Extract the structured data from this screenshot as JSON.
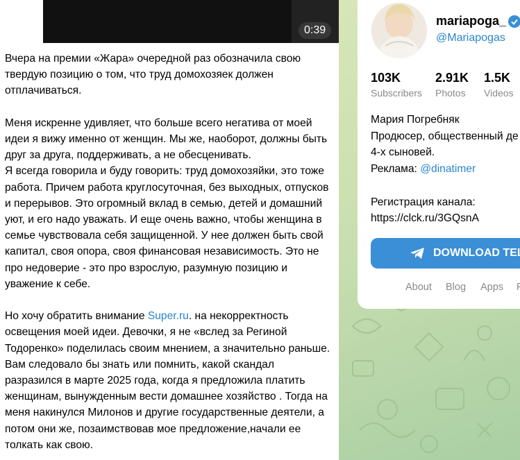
{
  "video": {
    "duration": "0:39"
  },
  "post": {
    "p1": "Вчера на премии «Жара» очередной раз обозначила свою твердую позицию о том, что труд домохозяек должен отплачиваться.",
    "p2a": "Меня искренне удивляет, что больше всего негатива от моей идеи я вижу именно от женщин. Мы же, наоборот, должны быть друг за друга, поддерживать, а не обесценивать.",
    "p2b": "Я всегда говорила и буду говорить: труд домохозяйки, это тоже работа. Причем работа круглосуточная, без выходных, отпусков и перерывов. Это огромный вклад в семью, детей и домашний уют, и его надо уважать. И еще очень важно, чтобы женщина в семье чувствовала себя защищенной. У нее должен быть свой капитал, своя опора, своя финансовая независимость. Это не про недоверие - это про взрослую, разумную позицию и уважение к себе.",
    "p3_pre": "Но хочу обратить внимание ",
    "p3_link": "Super.ru",
    "p3_post": ". на некорректность освещения моей идеи. Девочки, я не «вслед за Региной Тодоренко» поделилась своим мнением, а значительно раньше. Вам следовало бы знать или помнить, какой скандал разразился в марте 2025 года, когда я предложила платить женщинам, вынужденным вести домашнее хозяйство . Тогда на меня накинулся Милонов и другие государственные деятели, а потом они же, позаимствовав мое предложение,начали ее толкать как свою."
  },
  "channel": {
    "name": "mariapoga_",
    "handle": "@Mariapogas",
    "stats": [
      {
        "value": "103K",
        "label": "Subscribers"
      },
      {
        "value": "2.91K",
        "label": "Photos"
      },
      {
        "value": "1.5K",
        "label": "Videos"
      }
    ],
    "desc_line1": "Мария Погребняк",
    "desc_line2": "Продюсер, общественный де",
    "desc_line3": "4-х сыновей.",
    "ads_label": "Реклама: ",
    "ads_link": "@dinatimer",
    "reg_label": "Регистрация канала:",
    "reg_link": "https://clck.ru/3GQsnA",
    "download_button": "DOWNLOAD TELE",
    "footer": [
      "About",
      "Blog",
      "Apps",
      "P"
    ]
  },
  "colors": {
    "accent": "#3a8fd6",
    "link": "#2a84cc",
    "background": "#cfe0b6"
  }
}
